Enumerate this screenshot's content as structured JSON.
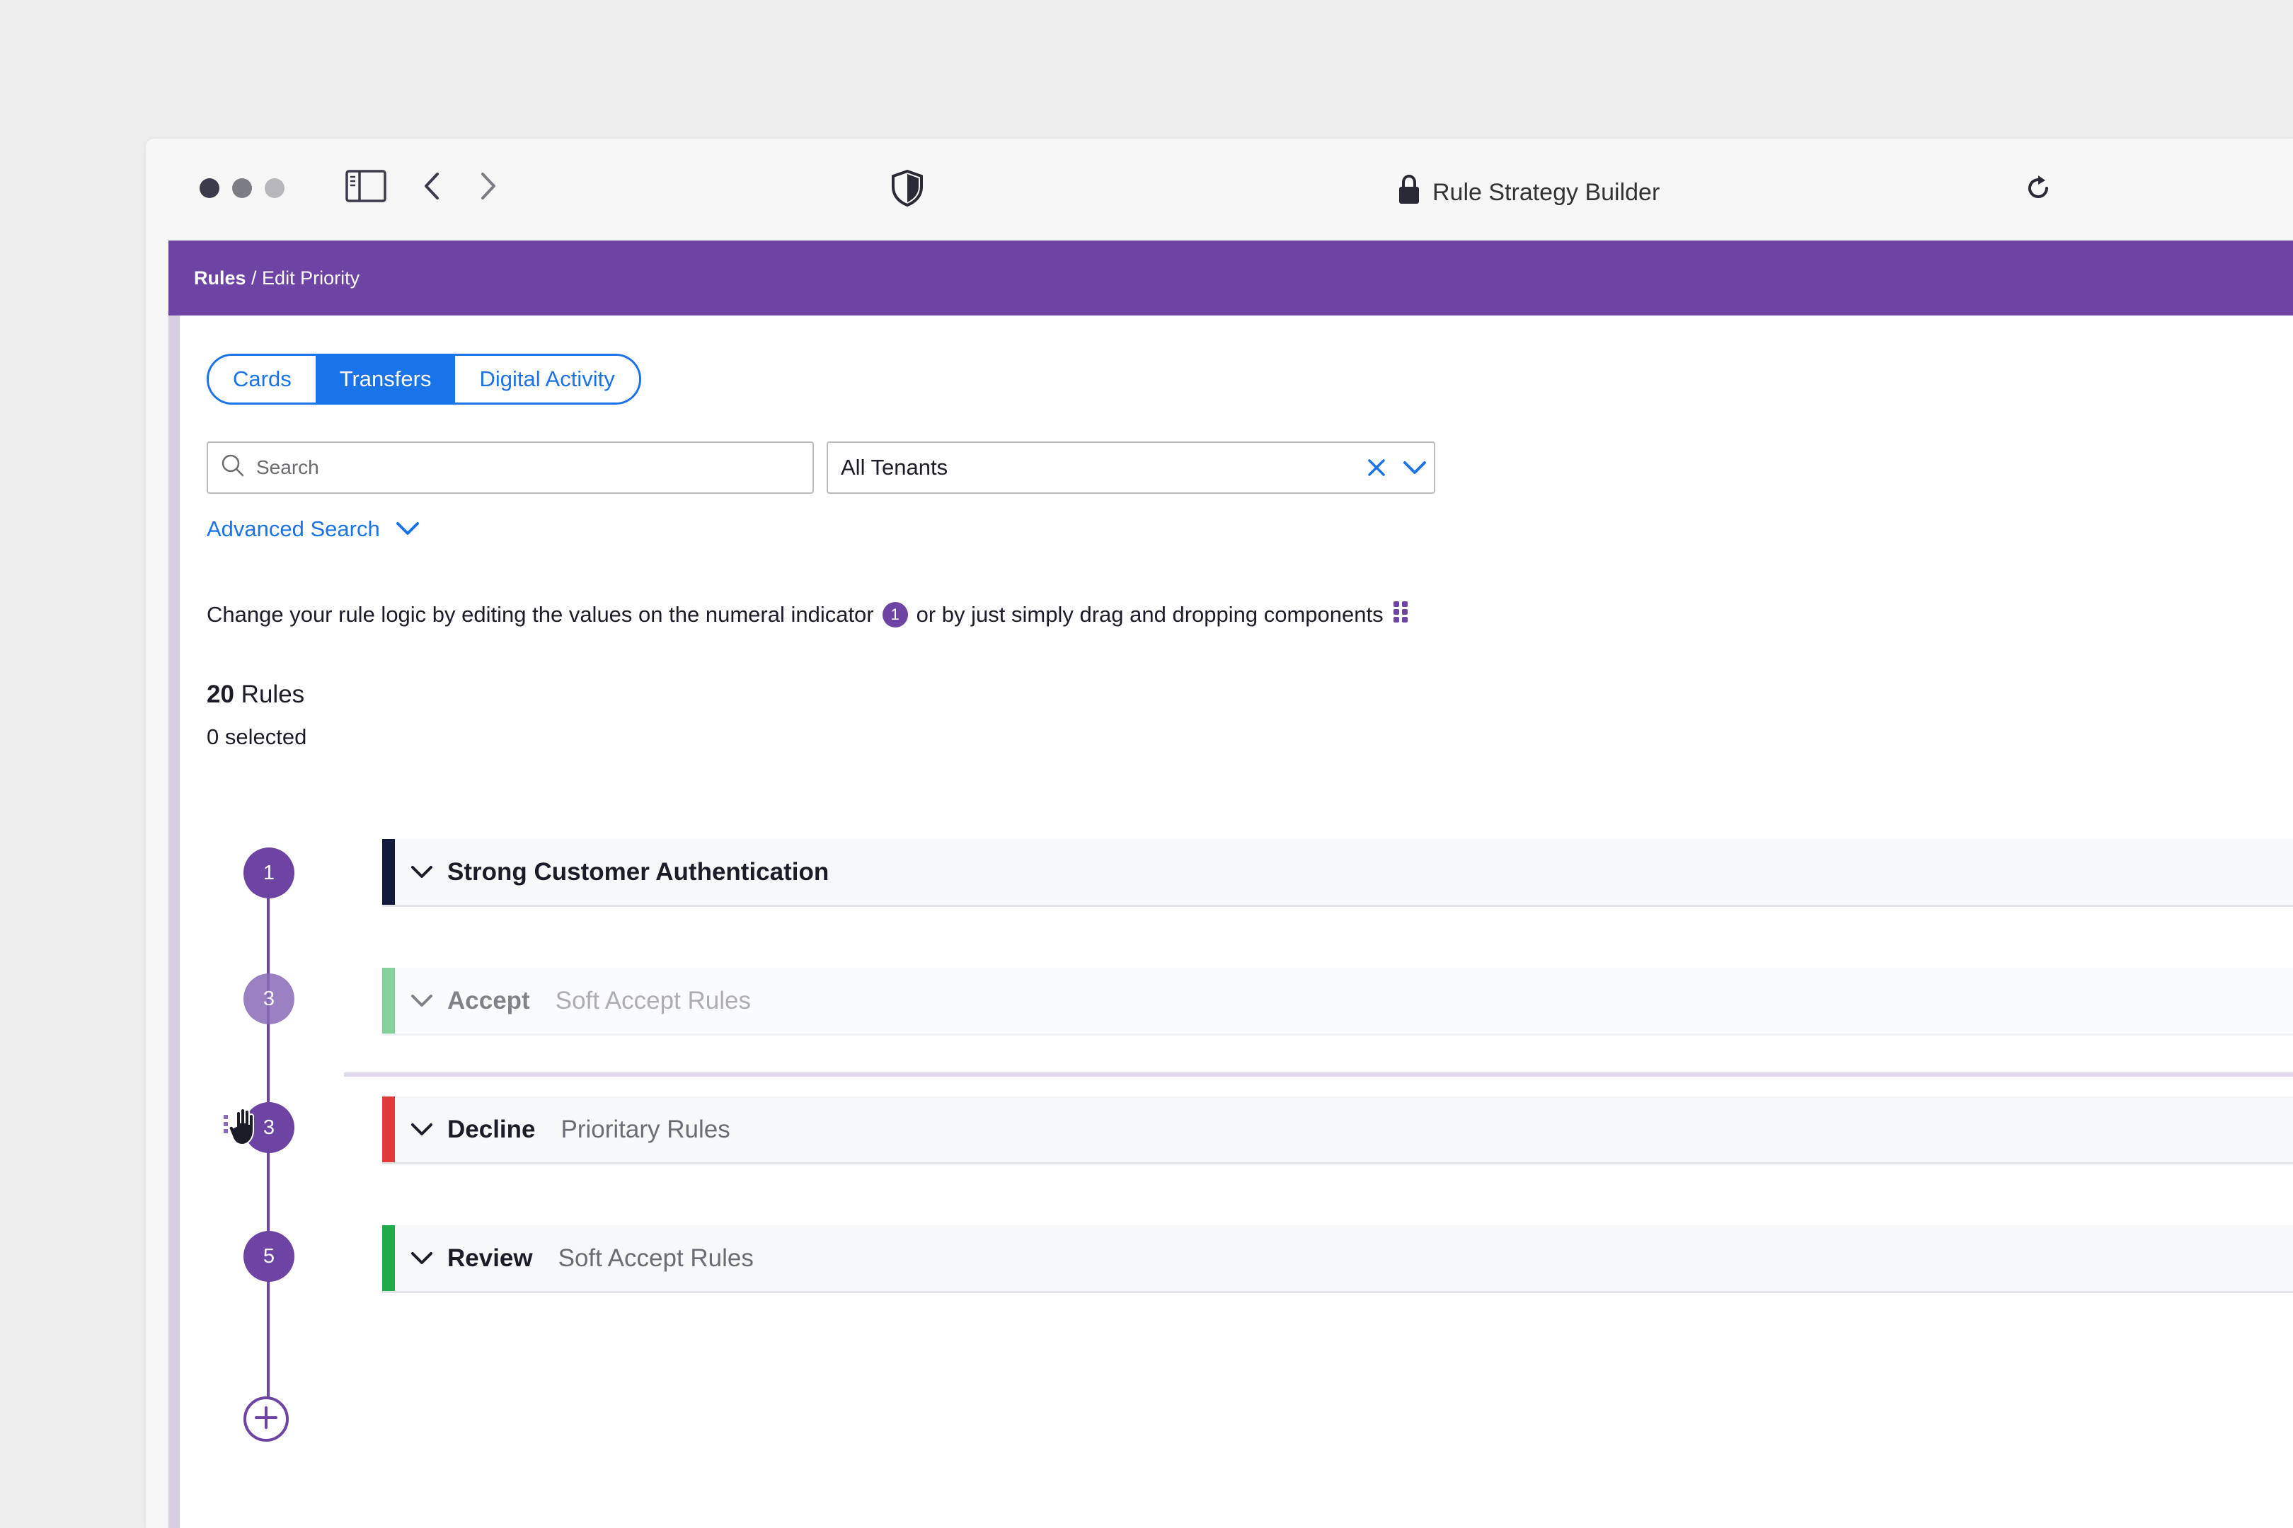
{
  "browser": {
    "address_title": "Rule Strategy Builder",
    "icons": [
      "sidebar-icon",
      "back-icon",
      "forward-icon",
      "shield-icon",
      "lock-icon",
      "reload-icon"
    ]
  },
  "breadcrumb": {
    "root": "Rules",
    "separator": " / ",
    "current": "Edit Priority"
  },
  "tabs": [
    {
      "label": "Cards",
      "active": false
    },
    {
      "label": "Transfers",
      "active": true
    },
    {
      "label": "Digital Activity",
      "active": false
    }
  ],
  "search": {
    "placeholder": "Search",
    "value": ""
  },
  "tenant": {
    "value": "All Tenants"
  },
  "advanced_search": {
    "label": "Advanced Search"
  },
  "info": {
    "text_before": "Change your rule logic by editing the values on the numeral indicator",
    "badge": "1",
    "text_after": "or by just simply drag and dropping components"
  },
  "summary": {
    "count": "20",
    "count_label": "Rules",
    "selected": "0 selected"
  },
  "rules": [
    {
      "priority": "1",
      "name": "Strong Customer Authentication",
      "type": "",
      "color": "#111a3a"
    },
    {
      "priority": "3",
      "name": "Accept",
      "type": "Soft Accept Rules",
      "color": "#1fad4b",
      "dragging": true
    },
    {
      "priority": "3",
      "name": "Decline",
      "type": "Prioritary Rules",
      "color": "#e03a3a"
    },
    {
      "priority": "5",
      "name": "Review",
      "type": "Soft Accept Rules",
      "color": "#1fad4b"
    }
  ],
  "colors": {
    "brand": "#6d44a3",
    "accent": "#1a73e8"
  }
}
